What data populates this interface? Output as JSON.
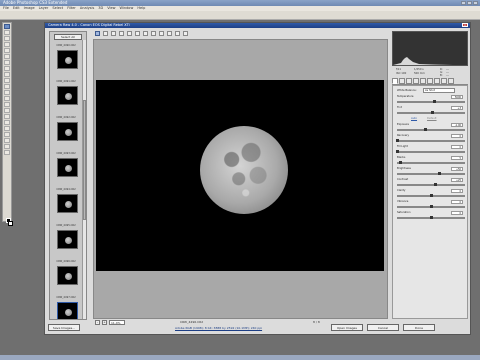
{
  "ps": {
    "title": "Adobe Photoshop CS3 Extended",
    "menu": [
      "File",
      "Edit",
      "Image",
      "Layer",
      "Select",
      "Filter",
      "Analysis",
      "3D",
      "View",
      "Window",
      "Help"
    ]
  },
  "dialog": {
    "title": "Camera Raw 4.0  -  Canon EOS Digital Rebel XTi",
    "close": "x"
  },
  "filmstrip": {
    "select_all": "Select All",
    "items": [
      {
        "label": "CRW_4490.CR2"
      },
      {
        "label": "CRW_4491.CR2"
      },
      {
        "label": "CRW_4492.CR2"
      },
      {
        "label": "CRW_4493.CR2"
      },
      {
        "label": "CRW_4494.CR2"
      },
      {
        "label": "CRW_4495.CR2"
      },
      {
        "label": "CRW_4496.CR2"
      },
      {
        "label": "CRW_4497.CR2"
      }
    ]
  },
  "preview": {
    "zoom": "11.4%",
    "minus": "-",
    "plus": "+",
    "filename": "CRW_4496.CR2",
    "count": "8 / 8"
  },
  "readout": {
    "r": "R:",
    "g": "G:",
    "b": "B:",
    "r_val": "---",
    "g_val": "---",
    "b_val": "---",
    "aperture": "f/11",
    "shutter": "1/250 s",
    "iso": "ISO 100",
    "focal": "500 mm"
  },
  "adjust": {
    "white_balance_label": "White Balance:",
    "white_balance_value": "As Shot",
    "sliders": [
      {
        "label": "Temperature",
        "value": "5600",
        "level": 0.55
      },
      {
        "label": "Tint",
        "value": "+3",
        "level": 0.52
      }
    ],
    "auto_label": "Auto",
    "default_label": "Default",
    "tone_sliders": [
      {
        "label": "Exposure",
        "value": "-1.00",
        "level": 0.42
      },
      {
        "label": "Recovery",
        "value": "0",
        "level": 0.0
      },
      {
        "label": "Fill Light",
        "value": "0",
        "level": 0.0
      },
      {
        "label": "Blacks",
        "value": "5",
        "level": 0.05
      },
      {
        "label": "Brightness",
        "value": "+50",
        "level": 0.62
      },
      {
        "label": "Contrast",
        "value": "+25",
        "level": 0.56
      },
      {
        "label": "Clarity",
        "value": "0",
        "level": 0.5
      },
      {
        "label": "Vibrance",
        "value": "0",
        "level": 0.5
      },
      {
        "label": "Saturation",
        "value": "0",
        "level": 0.5
      }
    ]
  },
  "bottom": {
    "save": "Save Images...",
    "workflow": "Adobe RGB (1998); 8 bit; 3888 by 2592 (10.1MP); 240 ppi",
    "open": "Open Images",
    "cancel": "Cancel",
    "done": "Done"
  }
}
